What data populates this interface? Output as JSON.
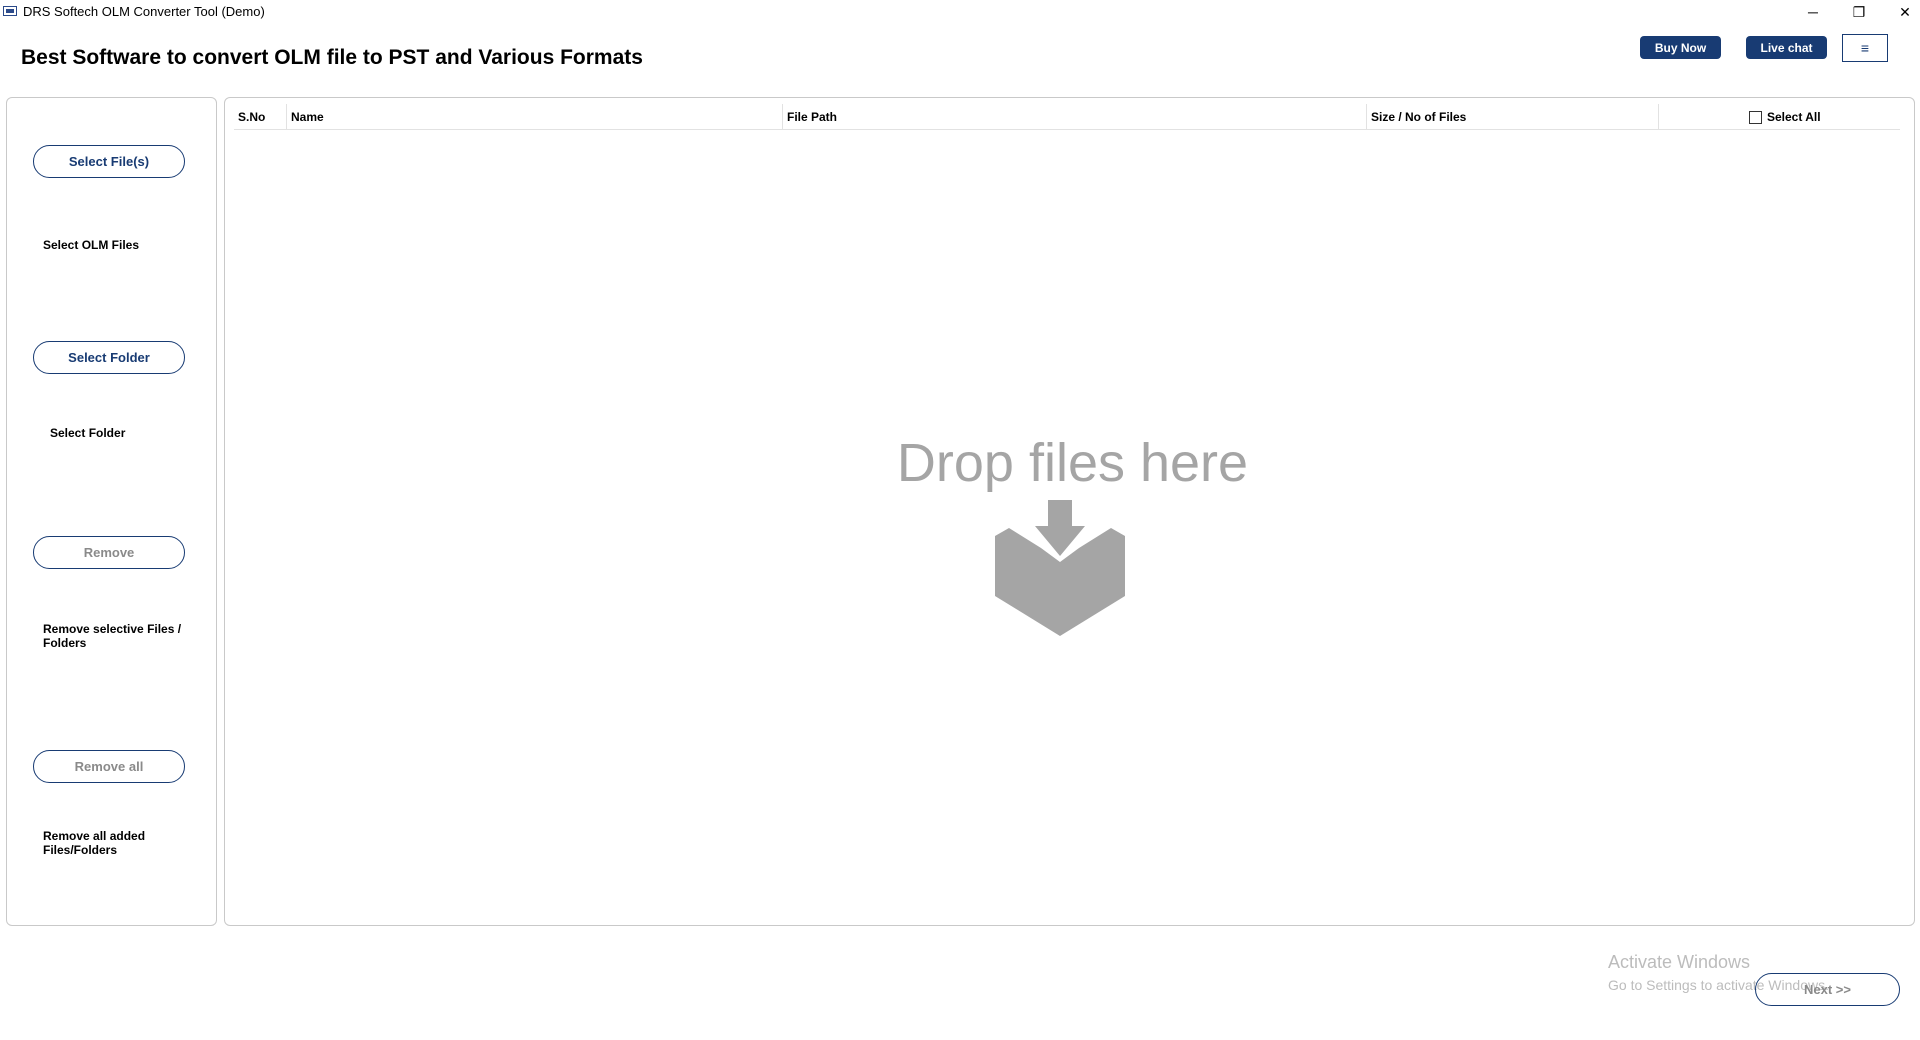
{
  "window": {
    "title": "DRS Softech OLM Converter Tool (Demo)",
    "minimize_glyph": "─",
    "maximize_glyph": "❐",
    "close_glyph": "✕"
  },
  "header": {
    "headline": "Best Software to convert OLM file to PST and Various Formats",
    "buy_now_label": "Buy Now",
    "live_chat_label": "Live chat",
    "menu_glyph": "≡"
  },
  "sidebar": {
    "select_files_label": "Select File(s)",
    "select_files_desc": "Select OLM Files",
    "select_folder_label": "Select Folder",
    "select_folder_desc": "Select Folder",
    "remove_label": "Remove",
    "remove_desc": "Remove selective Files / Folders",
    "remove_all_label": "Remove all",
    "remove_all_desc": "Remove all added Files/Folders"
  },
  "grid": {
    "columns": [
      "S.No",
      "Name",
      "File Path",
      "Size / No of Files"
    ],
    "select_all_label": "Select All",
    "drop_text": "Drop files here",
    "drop_icon": "tray-download-icon",
    "icon_color": "#a5a5a5"
  },
  "footer": {
    "watermark_title": "Activate Windows",
    "watermark_sub": "Go to Settings to activate Windows.",
    "next_label": "Next >>"
  },
  "colors": {
    "accent": "#183b73",
    "border": "#c9c9c9",
    "disabled_text": "#8a8a8a"
  }
}
